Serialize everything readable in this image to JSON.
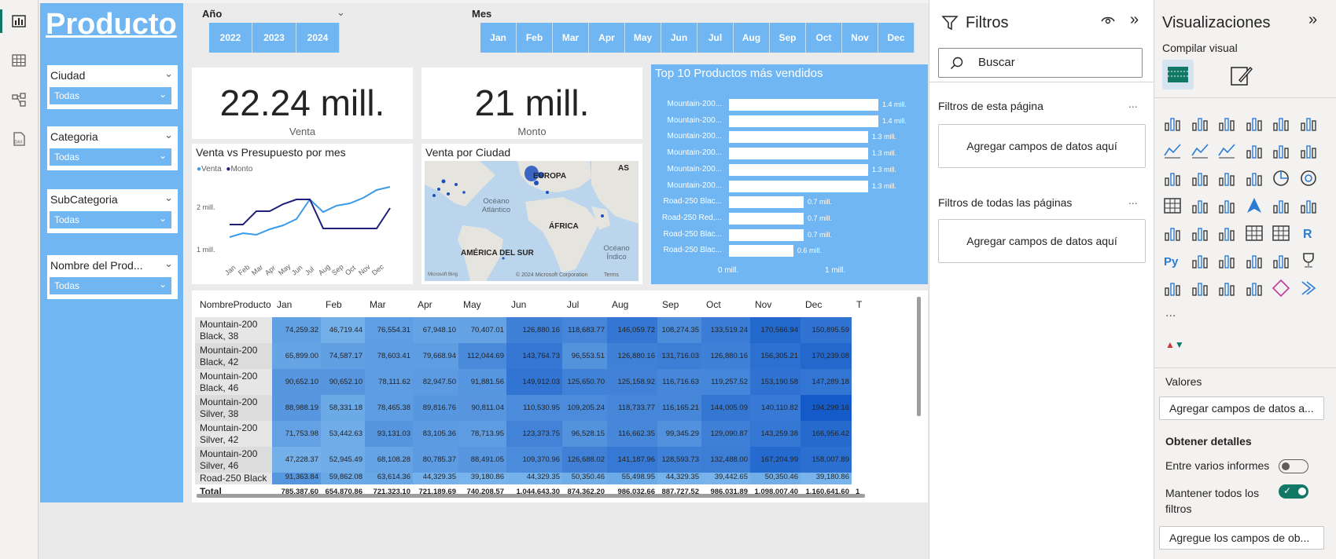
{
  "slicers": {
    "brand": "Producto",
    "ciudad": {
      "title": "Ciudad",
      "value": "Todas"
    },
    "categoria": {
      "title": "Categoria",
      "value": "Todas"
    },
    "subcategoria": {
      "title": "SubCategoria",
      "value": "Todas"
    },
    "nombre": {
      "title": "Nombre del Prod...",
      "value": "Todas"
    }
  },
  "year_slicer": {
    "label": "Año",
    "years": [
      "2022",
      "2023",
      "2024"
    ]
  },
  "month_slicer": {
    "label": "Mes",
    "months": [
      "Jan",
      "Feb",
      "Mar",
      "Apr",
      "May",
      "Jun",
      "Jul",
      "Aug",
      "Sep",
      "Oct",
      "Nov",
      "Dec"
    ]
  },
  "kpis": {
    "venta": {
      "value": "22.24 mill.",
      "label": "Venta"
    },
    "monto": {
      "value": "21 mill.",
      "label": "Monto"
    }
  },
  "line_chart": {
    "title": "Venta vs Presupuesto por mes",
    "legend": [
      "Venta",
      "Monto"
    ],
    "y_ticks": [
      "2 mill.",
      "1 mill."
    ],
    "x_ticks": [
      "Jan",
      "Feb",
      "Mar",
      "Apr",
      "May",
      "Jun",
      "Jul",
      "Aug",
      "Sep",
      "Oct",
      "Nov",
      "Dec"
    ]
  },
  "map": {
    "title": "Venta por Ciudad",
    "labels": {
      "europa": "EUROPA",
      "oceano_atl": "Océano Atlántico",
      "africa": "ÁFRICA",
      "america": "AMÉRICA DEL SUR",
      "oceano_ind": "Océano Índico",
      "as": "AS"
    },
    "copyright": "© 2024 Microsoft Corporation",
    "terms": "Terms",
    "bing": "Microsoft Bing"
  },
  "chart_data": {
    "type": "bar",
    "title": "Top 10 Productos más vendidos",
    "categories": [
      "Mountain-200...",
      "Mountain-200...",
      "Mountain-200...",
      "Mountain-200...",
      "Mountain-200...",
      "Mountain-200...",
      "Road-250 Blac...",
      "Road-250 Red,...",
      "Road-250 Blac...",
      "Road-250 Blac..."
    ],
    "values": [
      1.4,
      1.4,
      1.3,
      1.3,
      1.3,
      1.3,
      0.7,
      0.7,
      0.7,
      0.6
    ],
    "value_labels": [
      "1.4 mill.",
      "1.4 mill.",
      "1.3 mill.",
      "1.3 mill.",
      "1.3 mill.",
      "1.3 mill.",
      "0.7 mill.",
      "0.7 mill.",
      "0.7 mill.",
      "0.6 mill."
    ],
    "x_ticks": [
      "0 mill.",
      "1 mill."
    ],
    "xlim": [
      0,
      1.5
    ],
    "bar_color": "#ffffff",
    "background": "#6fb6f3"
  },
  "matrix": {
    "columns": [
      "NombreProducto",
      "Jan",
      "Feb",
      "Mar",
      "Apr",
      "May",
      "Jun",
      "Jul",
      "Aug",
      "Sep",
      "Oct",
      "Nov",
      "Dec",
      "T"
    ],
    "rows": [
      {
        "name": "Mountain-200 Black, 38",
        "values": [
          "74,259.32",
          "46,719.44",
          "76,554.31",
          "67,948.10",
          "70,407.01",
          "126,880.16",
          "118,683.77",
          "146,059.72",
          "108,274.35",
          "133,519.24",
          "170,566.94",
          "150,895.59"
        ]
      },
      {
        "name": "Mountain-200 Black, 42",
        "values": [
          "65,899.00",
          "74,587.17",
          "78,603.41",
          "79,668.94",
          "112,044.69",
          "143,764.73",
          "96,553.51",
          "126,880.16",
          "131,716.03",
          "126,880.16",
          "156,305.21",
          "170,239.08"
        ]
      },
      {
        "name": "Mountain-200 Black, 46",
        "values": [
          "90,652.10",
          "90,652.10",
          "78,111.62",
          "82,947.50",
          "91,881.56",
          "149,912.03",
          "125,650.70",
          "125,158.92",
          "116,716.63",
          "119,257.52",
          "153,190.58",
          "147,289.18"
        ]
      },
      {
        "name": "Mountain-200 Silver, 38",
        "values": [
          "88,988.19",
          "58,331.18",
          "78,465.38",
          "89,816.76",
          "90,811.04",
          "110,530.95",
          "109,205.24",
          "118,733.77",
          "116,165.21",
          "144,005.09",
          "140,110.82",
          "194,299.16"
        ]
      },
      {
        "name": "Mountain-200 Silver, 42",
        "values": [
          "71,753.98",
          "53,442.63",
          "93,131.03",
          "83,105.36",
          "78,713.95",
          "123,373.75",
          "96,528.15",
          "116,662.35",
          "99,345.29",
          "129,090.87",
          "143,259.38",
          "166,956.42"
        ]
      },
      {
        "name": "Mountain-200 Silver, 46",
        "values": [
          "47,228.37",
          "52,945.49",
          "68,108.28",
          "80,785.37",
          "88,491.05",
          "109,370.96",
          "126,688.02",
          "141,187.96",
          "128,593.73",
          "132,488.00",
          "167,204.99",
          "158,007.89"
        ]
      },
      {
        "name": "Road-250 Black",
        "values": [
          "91,363.84",
          "59,862.08",
          "63,614.36",
          "44,329.35",
          "39,180.86",
          "44,329.35",
          "50,350.46",
          "55,498.95",
          "44,329.35",
          "39,442.65",
          "50,350.46",
          "39,180.86"
        ]
      }
    ],
    "total": {
      "label": "Total",
      "values": [
        "785,387.60",
        "654,870.86",
        "721,323.10",
        "721,189.69",
        "740,208.57",
        "1,044,643.30",
        "874,362.20",
        "986,032.66",
        "887,727.52",
        "986,031.89",
        "1,098,007.40",
        "1,160,641.60",
        "1"
      ]
    }
  },
  "filters_pane": {
    "title": "Filtros",
    "search_placeholder": "Buscar",
    "page_filters": "Filtros de esta página",
    "all_filters": "Filtros de todas las páginas",
    "drop_here": "Agregar campos de datos aquí",
    "more": "..."
  },
  "viz_pane": {
    "title": "Visualizaciones",
    "build_visual": "Compilar visual",
    "more": "...",
    "valores": "Valores",
    "valores_drop": "Agregar campos de datos a...",
    "obtener": "Obtener detalles",
    "entre_varios": "Entre varios informes",
    "mantener": "Mantener todos los filtros",
    "agregue": "Agregue los campos de ob..."
  },
  "colors": {
    "accent_blue": "#6fb6f3",
    "series_venta": "#3a9be8",
    "series_monto": "#1f1f7a",
    "toggle_on": "#117865"
  }
}
